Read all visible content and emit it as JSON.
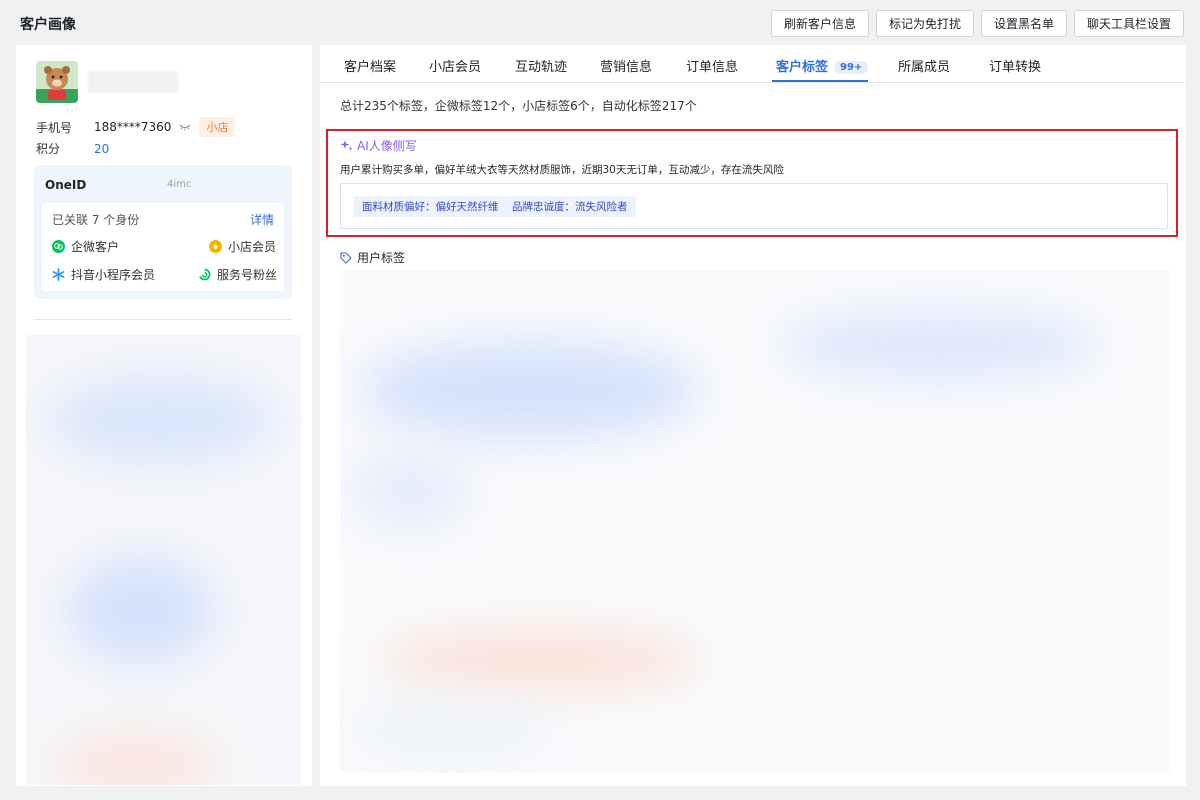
{
  "page": {
    "title": "客户画像"
  },
  "actions": [
    {
      "label": "刷新客户信息"
    },
    {
      "label": "标记为免打扰"
    },
    {
      "label": "设置黑名单"
    },
    {
      "label": "聊天工具栏设置"
    }
  ],
  "profile": {
    "phone_label": "手机号",
    "phone_value": "188****7360",
    "shop_badge": "小店",
    "points_label": "积分",
    "points_value": "20"
  },
  "oneid": {
    "title": "OneID",
    "code": "4imc",
    "linked_text": "已关联 7 个身份",
    "detail_link": "详情",
    "identities": [
      {
        "label": "企微客户",
        "icon": "wecom-icon",
        "color": "#07c160"
      },
      {
        "label": "小店会员",
        "icon": "shop-member-icon",
        "color": "#f5b400"
      },
      {
        "label": "抖音小程序会员",
        "icon": "douyin-miniapp-icon",
        "color": "#2a9df4"
      },
      {
        "label": "服务号粉丝",
        "icon": "service-account-icon",
        "color": "#07c160"
      }
    ]
  },
  "tabs": [
    {
      "label": "客户档案"
    },
    {
      "label": "小店会员"
    },
    {
      "label": "互动轨迹"
    },
    {
      "label": "营销信息"
    },
    {
      "label": "订单信息"
    },
    {
      "label": "客户标签",
      "badge": "99+",
      "active": true
    },
    {
      "label": "所属成员"
    },
    {
      "label": "订单转换"
    }
  ],
  "summary": "总计235个标签，企微标签12个，小店标签6个，自动化标签217个",
  "ai_portrait": {
    "title": "AI人像侧写",
    "description": "用户累计购买多单，偏好羊绒大衣等天然材质服饰，近期30天无订单，互动减少，存在流失风险",
    "tags": [
      "面料材质偏好：偏好天然纤维",
      "品牌忠诚度：流失风险者"
    ]
  },
  "user_tags": {
    "title": "用户标签"
  },
  "colors": {
    "accent": "#2f6fe0",
    "ai_purple": "#8a5cf5",
    "highlight_red": "#e02020"
  }
}
